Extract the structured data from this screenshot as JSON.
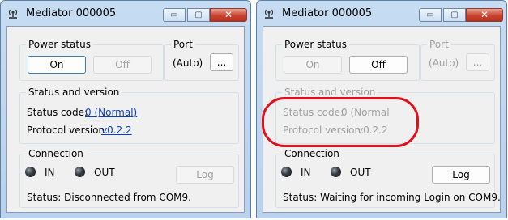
{
  "windows": [
    {
      "title": "Mediator 000005",
      "power_status": {
        "label": "Power status",
        "on_label": "On",
        "off_label": "Off"
      },
      "port": {
        "label": "Port",
        "value": "(Auto)",
        "browse_label": "..."
      },
      "status_version": {
        "label": "Status and version",
        "status_code_label": "Status code:",
        "status_code_value": "0 (Normal)",
        "protocol_label": "Protocol version:",
        "protocol_value": "v0.2.2"
      },
      "connection": {
        "label": "Connection",
        "in_label": "IN",
        "out_label": "OUT",
        "log_label": "Log",
        "status_text": "Status: Disconnected from COM9."
      }
    },
    {
      "title": "Mediator 000005",
      "power_status": {
        "label": "Power status",
        "on_label": "On",
        "off_label": "Off"
      },
      "port": {
        "label": "Port",
        "value": "(Auto)",
        "browse_label": "..."
      },
      "status_version": {
        "label": "Status and version",
        "status_code_label": "Status code:",
        "status_code_value": "0 (Normal",
        "protocol_label": "Protocol version:",
        "protocol_value": "v0.2.2"
      },
      "connection": {
        "label": "Connection",
        "in_label": "IN",
        "out_label": "OUT",
        "log_label": "Log",
        "status_text": "Status: Waiting for incoming Login on COM9."
      }
    }
  ],
  "caption_buttons": {
    "minimize": "▭",
    "maximize": "▢",
    "close": "✕"
  },
  "colors": {
    "annotation": "#e0101a",
    "link": "#0a40c0",
    "disabled_text": "#a0a0a0"
  }
}
